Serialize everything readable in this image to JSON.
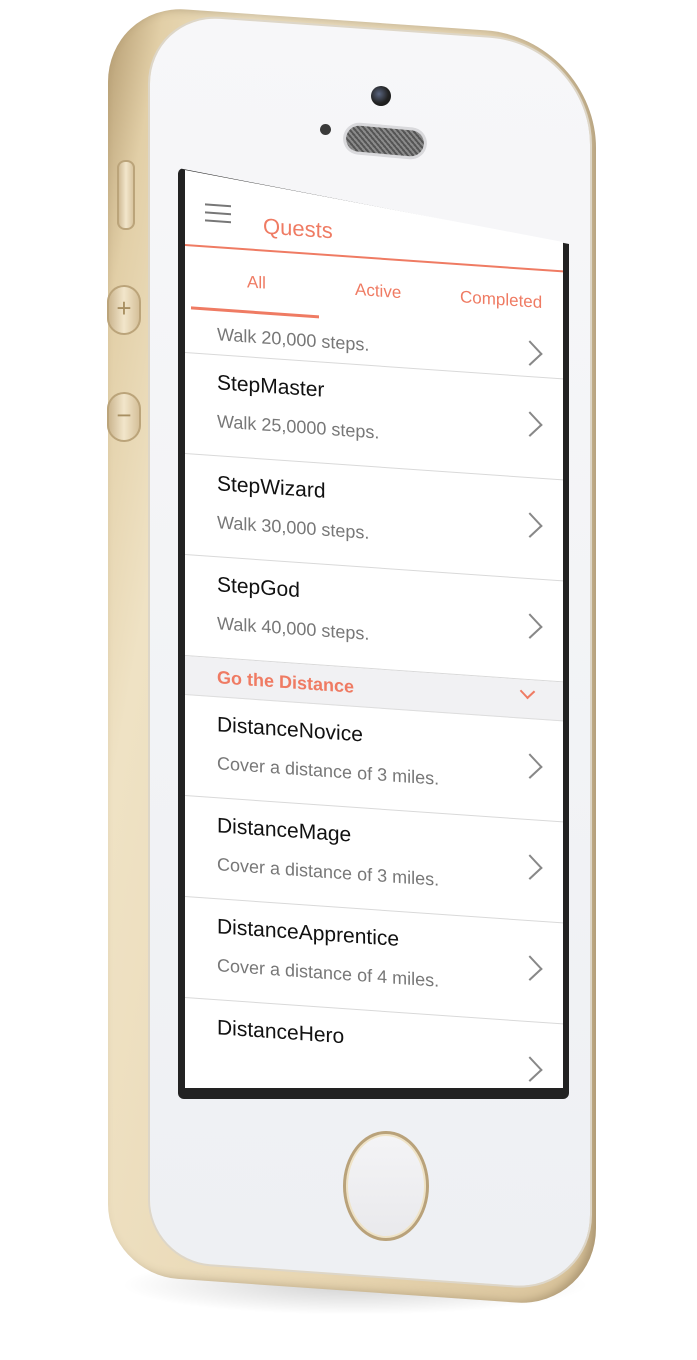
{
  "nav": {
    "title": "Quests"
  },
  "tabs": [
    {
      "label": "All",
      "selected": true
    },
    {
      "label": "Active",
      "selected": false
    },
    {
      "label": "Completed",
      "selected": false
    }
  ],
  "quests_top": [
    {
      "title": "",
      "description": "Walk 20,000 steps."
    },
    {
      "title": "StepMaster",
      "description": "Walk 25,0000 steps."
    },
    {
      "title": "StepWizard",
      "description": "Walk 30,000 steps."
    },
    {
      "title": "StepGod",
      "description": "Walk 40,000 steps."
    }
  ],
  "section": {
    "label": "Go the Distance"
  },
  "quests_distance": [
    {
      "title": "DistanceNovice",
      "description": "Cover a distance of 3 miles."
    },
    {
      "title": "DistanceMage",
      "description": "Cover a distance of 3 miles."
    },
    {
      "title": "DistanceApprentice",
      "description": "Cover a distance of 4 miles."
    },
    {
      "title": "DistanceHero",
      "description": ""
    }
  ],
  "colors": {
    "accent": "#ef7b63",
    "phone_gold": "#e2cfa7"
  },
  "icons": [
    "hamburger-menu-icon",
    "chevron-right-icon",
    "chevron-down-icon"
  ]
}
